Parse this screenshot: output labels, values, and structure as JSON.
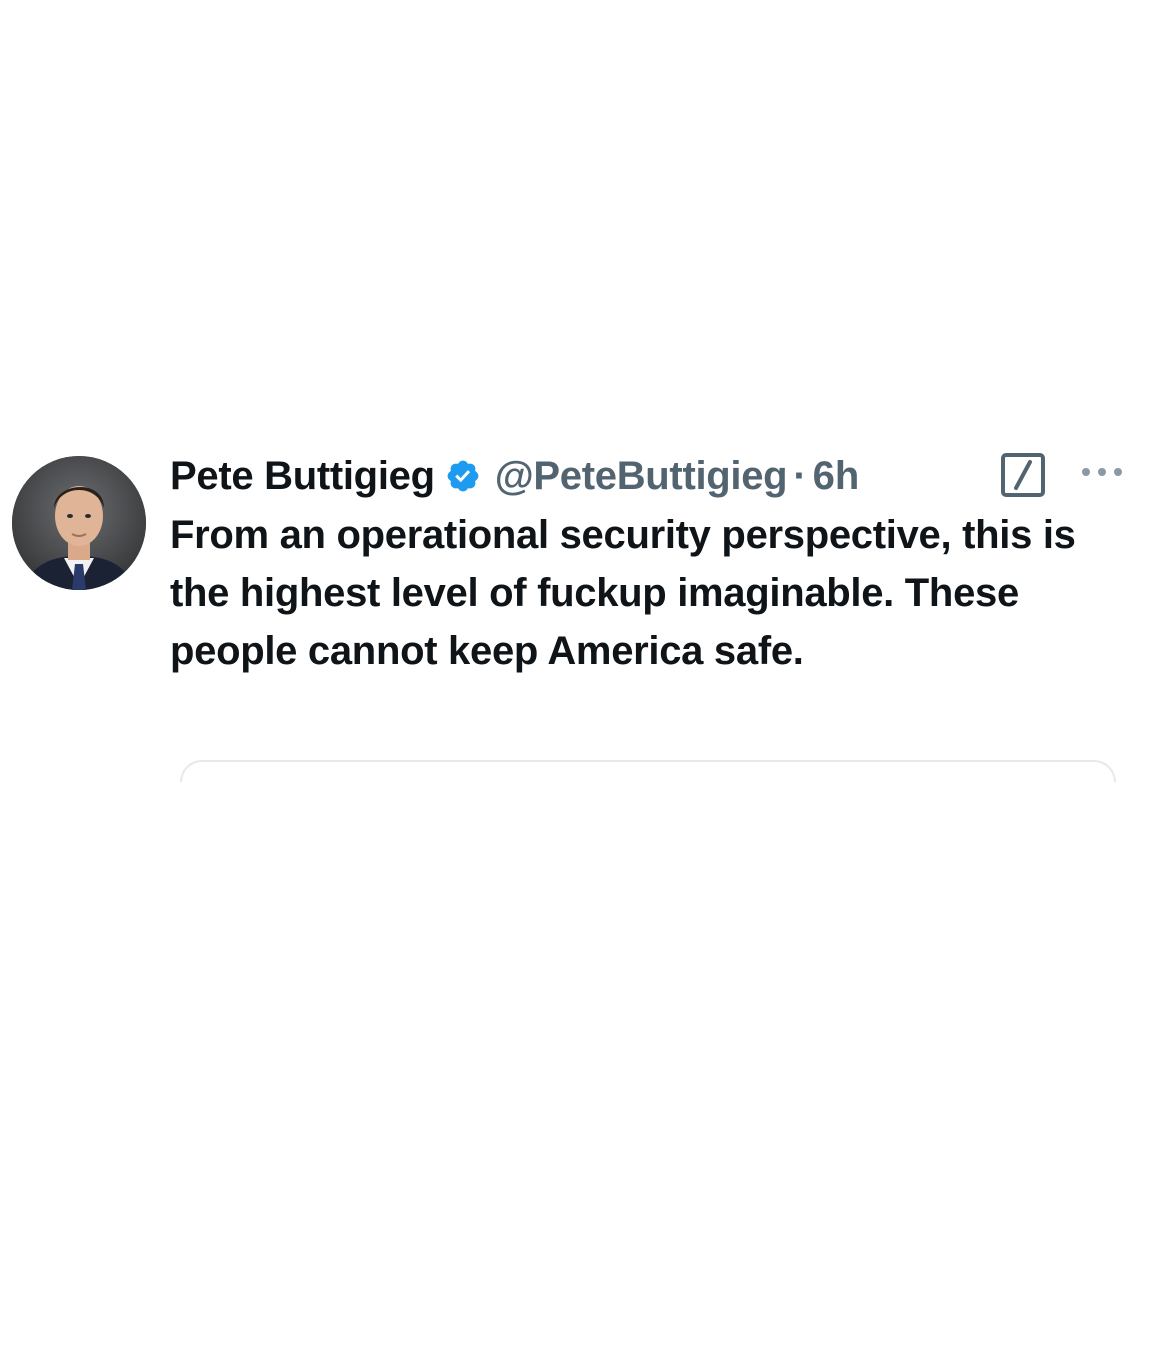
{
  "tweet": {
    "author_name": "Pete Buttigieg",
    "author_handle": "@PeteButtigieg",
    "separator": "·",
    "timestamp": "6h",
    "verified_icon": "verified-badge-icon",
    "text": "From an operational security perspective, this is the highest level of fuckup imaginable. These people cannot keep America safe."
  },
  "icons": {
    "edit": "edit-square-icon",
    "more": "more-options-icon"
  },
  "colors": {
    "text_primary": "#0f1419",
    "text_secondary": "#536471",
    "verified_blue": "#1d9bf0",
    "divider": "#e6e9ec"
  }
}
